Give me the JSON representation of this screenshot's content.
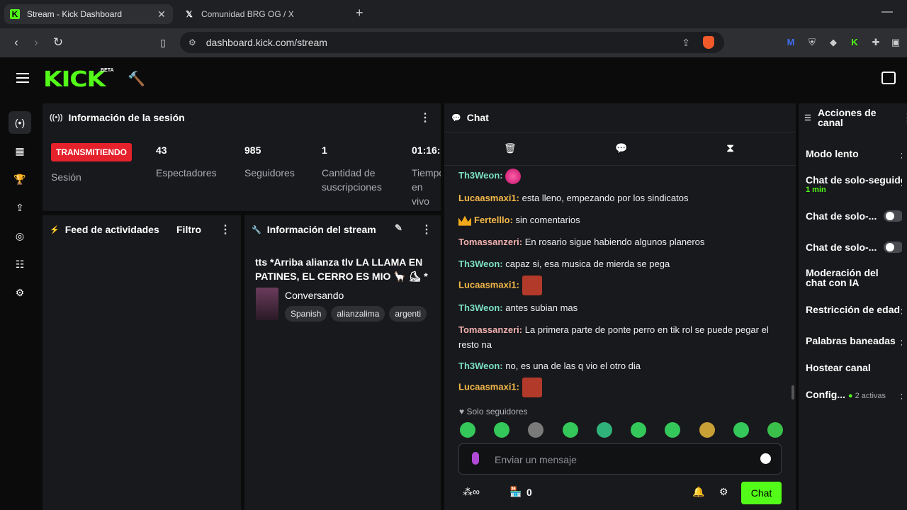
{
  "browser": {
    "tabs": [
      {
        "title": "Stream - Kick Dashboard",
        "active": true
      },
      {
        "title": "Comunidad BRG OG / X",
        "active": false
      }
    ],
    "url": "dashboard.kick.com/stream"
  },
  "app": {
    "logo": "KICK",
    "logo_badge": "BETA",
    "accent_color": "#53fc18"
  },
  "session": {
    "title": "Información de la sesión",
    "status": "TRANSMITIENDO",
    "status_label": "Sesión",
    "stats": [
      {
        "value": "43",
        "label": "Espectadores"
      },
      {
        "value": "985",
        "label": "Seguidores"
      },
      {
        "value": "1",
        "label": "Cantidad de suscripciones"
      },
      {
        "value": "01:16:",
        "label": "Tiempo en vivo"
      }
    ]
  },
  "feed": {
    "title": "Feed de actividades",
    "filter": "Filtro"
  },
  "stream_info": {
    "title": "Información del stream",
    "stream_title": "tts *Arriba alianza tlv LA LLAMA EN PATINES, EL CERRO ES MIO 🦙 ⛸ *",
    "category": "Conversando",
    "tags": [
      "Spanish",
      "alianzalima",
      "argenti"
    ]
  },
  "chat": {
    "title": "Chat",
    "messages": [
      {
        "user": "Th3Weon",
        "color": "#7be0c4",
        "text": "",
        "emote": true
      },
      {
        "user": "Lucaasmaxi1",
        "color": "#f5b94a",
        "text": "esta lleno, empezando por los sindicatos"
      },
      {
        "user": "Fertelllo",
        "color": "#f5b94a",
        "text": "sin comentarios",
        "badge": "crown"
      },
      {
        "user": "Tomassanzeri",
        "color": "#f0b0b0",
        "text": "En rosario sigue habiendo algunos planeros"
      },
      {
        "user": "Th3Weon",
        "color": "#7be0c4",
        "text": "capaz si, esa musica de mierda se pega"
      },
      {
        "user": "Lucaasmaxi1",
        "color": "#f5b94a",
        "text": "",
        "emote": true
      },
      {
        "user": "Th3Weon",
        "color": "#7be0c4",
        "text": "antes subian mas"
      },
      {
        "user": "Tomassanzeri",
        "color": "#f0b0b0",
        "text": "La primera parte de ponte perro en tik rol se puede pegar el resto na"
      },
      {
        "user": "Th3Weon",
        "color": "#7be0c4",
        "text": "no, es una de las q vio el otro dia"
      },
      {
        "user": "Lucaasmaxi1",
        "color": "#f5b94a",
        "text": "",
        "emote": true
      }
    ],
    "followers_only": "Solo seguidores",
    "input_placeholder": "Enviar un mensaje",
    "points": "0",
    "send_label": "Chat"
  },
  "channel_actions": {
    "title": "Acciones de canal",
    "items": [
      {
        "label": "Modo lento",
        "type": "chevron"
      },
      {
        "label": "Chat de solo-seguidores",
        "sub": "1 min",
        "type": "chevron"
      },
      {
        "label": "Chat de solo-...",
        "type": "toggle"
      },
      {
        "label": "Chat de solo-...",
        "type": "toggle"
      },
      {
        "label": "Moderación del chat con IA",
        "type": "link"
      },
      {
        "label": "Restricción de edad",
        "type": "chevron"
      },
      {
        "label": "Palabras baneadas",
        "type": "chevron"
      },
      {
        "label": "Hostear canal",
        "type": "none"
      },
      {
        "label": "Config...",
        "sub": "2 activas",
        "type": "chevron"
      }
    ]
  }
}
